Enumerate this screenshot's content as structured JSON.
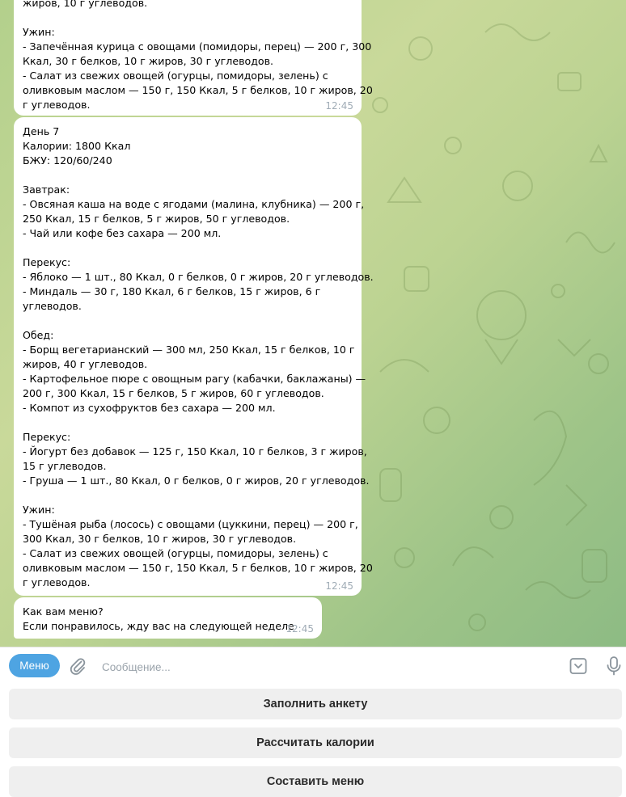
{
  "chat": {
    "messages": [
      {
        "id": "bubble-top",
        "lines": [
          "жиров, 10 г углеводов.",
          "",
          "Ужин:",
          "- Запечённая курица с овощами (помидоры, перец) — 200 г, 300",
          "Ккал, 30 г белков, 10 г жиров, 30 г углеводов.",
          "- Салат из свежих овощей (огурцы, помидоры, зелень) с",
          "оливковым маслом — 150 г, 150 Ккал, 5 г белков, 10 г жиров, 20",
          "г углеводов."
        ],
        "time": "12:45"
      },
      {
        "id": "bubble-day7",
        "lines": [
          "День 7",
          "Калории: 1800 Ккал",
          "БЖУ: 120/60/240",
          "",
          "Завтрак:",
          "- Овсяная каша на воде с ягодами (малина, клубника) — 200 г,",
          "250 Ккал, 15 г белков, 5 г жиров, 50 г углеводов.",
          "- Чай или кофе без сахара — 200 мл.",
          "",
          "Перекус:",
          "- Яблоко — 1 шт., 80 Ккал, 0 г белков, 0 г жиров, 20 г углеводов.",
          "- Миндаль — 30 г, 180 Ккал, 6 г белков, 15 г жиров, 6 г",
          "углеводов.",
          "",
          "Обед:",
          "- Борщ вегетарианский — 300 мл, 250 Ккал, 15 г белков, 10 г",
          "жиров, 40 г углеводов.",
          "- Картофельное пюре с овощным рагу (кабачки, баклажаны) —",
          "200 г, 300 Ккал, 15 г белков, 5 г жиров, 60 г углеводов.",
          "- Компот из сухофруктов без сахара — 200 мл.",
          "",
          "Перекус:",
          "- Йогурт без добавок — 125 г, 150 Ккал, 10 г белков, 3 г жиров,",
          "15 г углеводов.",
          "- Груша — 1 шт., 80 Ккал, 0 г белков, 0 г жиров, 20 г углеводов.",
          "",
          "Ужин:",
          "- Тушёная рыба (лосось) с овощами (цуккини, перец) — 200 г,",
          "300 Ккал, 30 г белков, 10 г жиров, 30 г углеводов.",
          "- Салат из свежих овощей (огурцы, помидоры, зелень) с",
          "оливковым маслом — 150 г, 150 Ккал, 5 г белков, 10 г жиров, 20",
          "г углеводов."
        ],
        "time": "12:45"
      },
      {
        "id": "bubble-last",
        "lines": [
          "Как вам меню?",
          "Если понравилось, жду вас на следующей неделе"
        ],
        "time": "12:45"
      }
    ]
  },
  "composer": {
    "menu_label": "Меню",
    "placeholder": "Сообщение...",
    "icons": [
      "paperclip-icon",
      "keyboard-icon",
      "microphone-icon"
    ]
  },
  "keyboard": {
    "buttons": [
      "Заполнить анкету",
      "Рассчитать калории",
      "Составить меню"
    ]
  },
  "colors": {
    "accent": "#4ea4e2",
    "bubble": "#ffffff",
    "time": "#a0acb6",
    "wallpaper_start": "#b3d08c",
    "wallpaper_end": "#8dbb84"
  }
}
